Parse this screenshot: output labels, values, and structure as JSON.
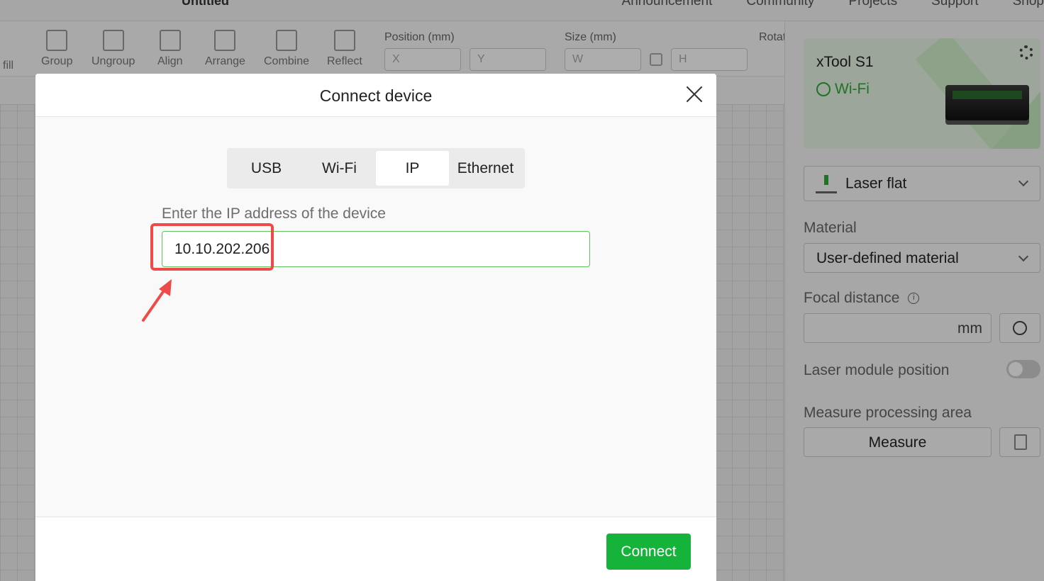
{
  "app": {
    "doc_title": "Untitled",
    "top_links": [
      "Announcement",
      "Community",
      "Projects",
      "Support",
      "Shop"
    ]
  },
  "toolbar": {
    "fill_label": "fill",
    "tools": [
      "Group",
      "Ungroup",
      "Align",
      "Arrange",
      "Combine",
      "Reflect"
    ],
    "position_label": "Position (mm)",
    "x_placeholder": "X",
    "y_placeholder": "Y",
    "size_label": "Size (mm)",
    "w_placeholder": "W",
    "h_placeholder": "H",
    "rotate_label": "Rotat"
  },
  "right_panel": {
    "device_name": "xTool S1",
    "connection": "Wi-Fi",
    "mode": "Laser flat",
    "material_label": "Material",
    "material_value": "User-defined material",
    "focal_label": "Focal distance",
    "focal_unit": "mm",
    "laser_module_label": "Laser module position",
    "laser_module_enabled": false,
    "measure_label": "Measure processing area",
    "measure_button": "Measure"
  },
  "modal": {
    "title": "Connect device",
    "tabs": [
      "USB",
      "Wi-Fi",
      "IP",
      "Ethernet"
    ],
    "active_tab": "IP",
    "ip_label": "Enter the IP address of the device",
    "ip_value": "10.10.202.206",
    "connect_button": "Connect"
  },
  "colors": {
    "accent_green": "#15b33a",
    "input_border_green": "#5cc45f",
    "annotation_red": "#ee4a4a"
  }
}
